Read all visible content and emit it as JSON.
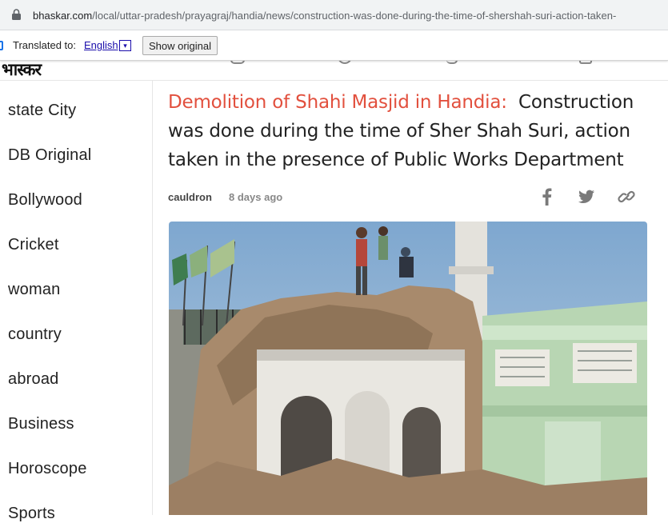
{
  "browser": {
    "url_host": "bhaskar.com",
    "url_path": "/local/uttar-pradesh/prayagraj/handia/news/construction-was-done-during-the-time-of-shershah-suri-action-taken-"
  },
  "translate_bar": {
    "label": "Translated to:",
    "language": "English",
    "dropdown_glyph": "▾",
    "show_original": "Show original"
  },
  "site": {
    "logo_text": "भास्कर"
  },
  "sidebar": {
    "items": [
      {
        "label": "state City"
      },
      {
        "label": "DB Original"
      },
      {
        "label": "Bollywood"
      },
      {
        "label": "Cricket"
      },
      {
        "label": "woman"
      },
      {
        "label": "country"
      },
      {
        "label": "abroad"
      },
      {
        "label": "Business"
      },
      {
        "label": "Horoscope"
      },
      {
        "label": "Sports"
      }
    ]
  },
  "article": {
    "headline_highlight": "Demolition of Shahi Masjid in Handia:",
    "headline_rest": "Construction was done during the time of Sher Shah Suri, action taken in the presence of Public Works Department",
    "author": "cauldron",
    "time_ago": "8 days ago"
  },
  "share": {
    "icons": [
      "facebook-icon",
      "twitter-icon",
      "link-icon"
    ]
  },
  "colors": {
    "headline_accent": "#e2503e",
    "link": "#1a0dab"
  }
}
